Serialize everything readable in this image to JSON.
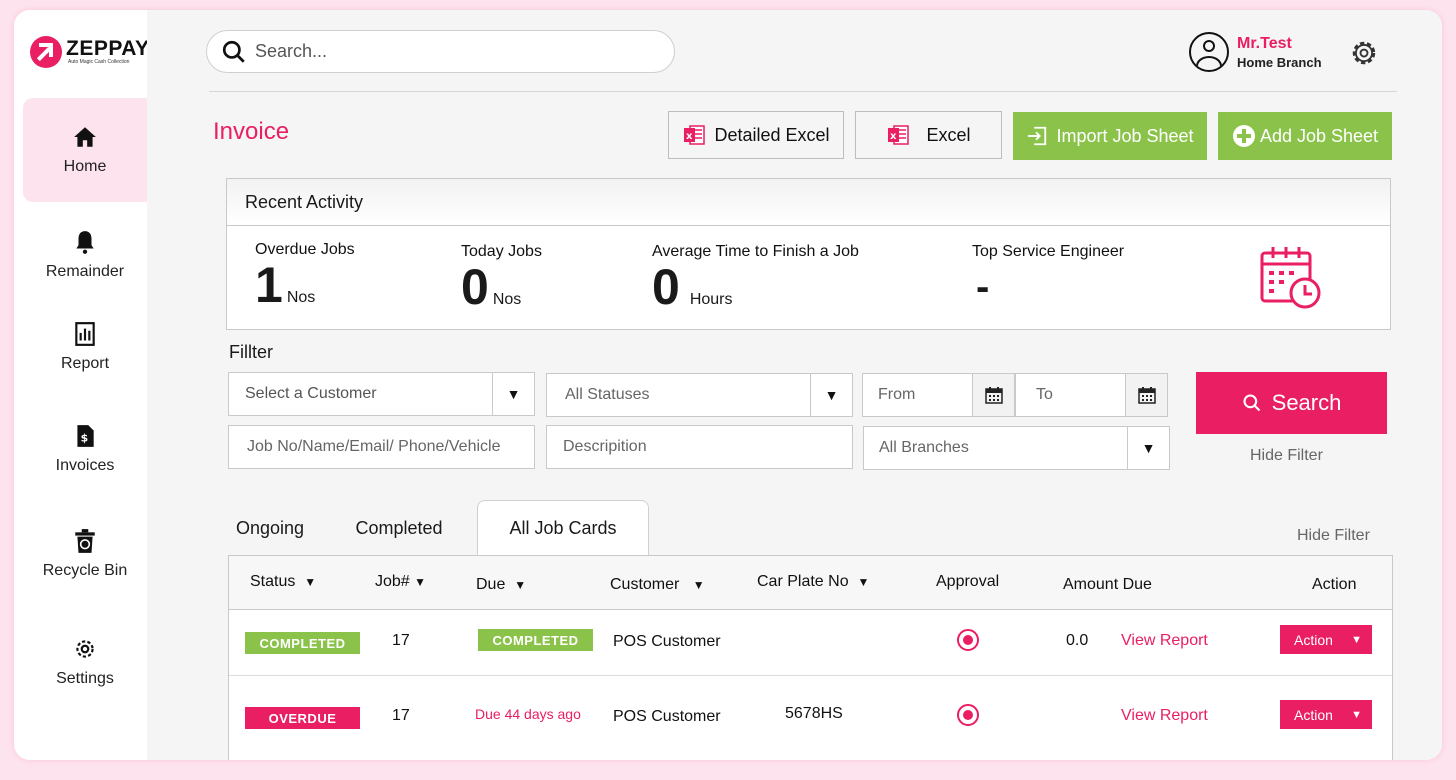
{
  "brand": {
    "name": "ZEPPAY",
    "tagline": "Auto Magic Cash Collection"
  },
  "sidebar": {
    "items": [
      {
        "label": "Home",
        "icon": "home-icon"
      },
      {
        "label": "Remainder",
        "icon": "bell-icon"
      },
      {
        "label": "Report",
        "icon": "report-icon"
      },
      {
        "label": "Invoices",
        "icon": "invoice-icon"
      },
      {
        "label": "Recycle Bin",
        "icon": "recycle-bin-icon"
      },
      {
        "label": "Settings",
        "icon": "gear-icon"
      }
    ]
  },
  "header": {
    "search_placeholder": "Search...",
    "user_name": "Mr.Test",
    "user_branch": "Home Branch"
  },
  "page": {
    "title": "Invoice",
    "buttons": {
      "detailed_excel": "Detailed Excel",
      "excel": "Excel",
      "import_job_sheet": "Import Job Sheet",
      "add_job_sheet": "Add Job Sheet"
    }
  },
  "activity": {
    "title": "Recent Activity",
    "stats": [
      {
        "label": "Overdue Jobs",
        "value": "1",
        "unit": "Nos"
      },
      {
        "label": "Today Jobs",
        "value": "0",
        "unit": "Nos"
      },
      {
        "label": "Average Time to Finish a Job",
        "value": "0",
        "unit": "Hours"
      },
      {
        "label": "Top Service Engineer",
        "value": "-",
        "unit": ""
      }
    ]
  },
  "filter": {
    "label": "Fillter",
    "customer": "Select a Customer",
    "status": "All Statuses",
    "from": "From",
    "to": "To",
    "job_search": "Job No/Name/Email/ Phone/Vehicle",
    "description": "Descripition",
    "branches": "All Branches",
    "search_button": "Search",
    "hide_filter": "Hide Filter"
  },
  "tabs": [
    "Ongoing",
    "Completed",
    "All Job Cards"
  ],
  "hide_filter_right": "Hide Filter",
  "table": {
    "columns": [
      "Status",
      "Job#",
      "Due",
      "Customer",
      "Car Plate No",
      "Approval",
      "Amount Due",
      "Action"
    ],
    "rows": [
      {
        "status": "COMPLETED",
        "job": "17",
        "due": "COMPLETED",
        "customer": "POS Customer",
        "plate": "",
        "amount": "0.0",
        "report": "View Report",
        "action": "Action"
      },
      {
        "status": "OVERDUE",
        "job": "17",
        "due": "Due 44 days ago",
        "customer": "POS Customer",
        "plate": "5678HS",
        "amount": "",
        "report": "View Report",
        "action": "Action"
      }
    ]
  },
  "colors": {
    "accent": "#e91e63",
    "success": "#8bc34a",
    "background": "#fde3ee"
  }
}
